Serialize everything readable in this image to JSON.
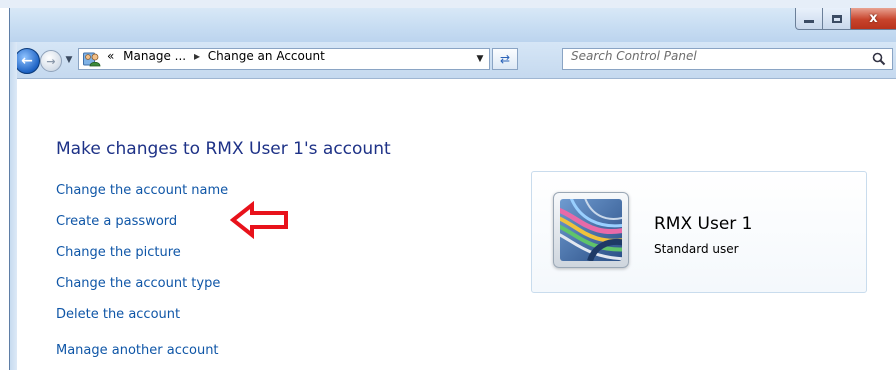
{
  "window": {
    "minimize_glyph": "minimize",
    "maximize_glyph": "maximize",
    "close_glyph": "x"
  },
  "nav": {
    "back_icon": "back-arrow-icon",
    "forward_icon": "forward-arrow-icon",
    "breadcrumb_prefix": "«",
    "breadcrumb_parent": "Manage ...",
    "breadcrumb_separator": "▸",
    "breadcrumb_current": "Change an Account",
    "search_placeholder": "Search Control Panel"
  },
  "main": {
    "title": "Make changes to RMX User 1's account",
    "tasks": [
      {
        "label": "Change the account name"
      },
      {
        "label": "Create a password"
      },
      {
        "label": "Change the picture"
      },
      {
        "label": "Change the account type"
      },
      {
        "label": "Delete the account"
      },
      {
        "label": "Manage another account"
      }
    ],
    "annotation_color": "#e8121b"
  },
  "user": {
    "name": "RMX User 1",
    "type": "Standard user"
  }
}
